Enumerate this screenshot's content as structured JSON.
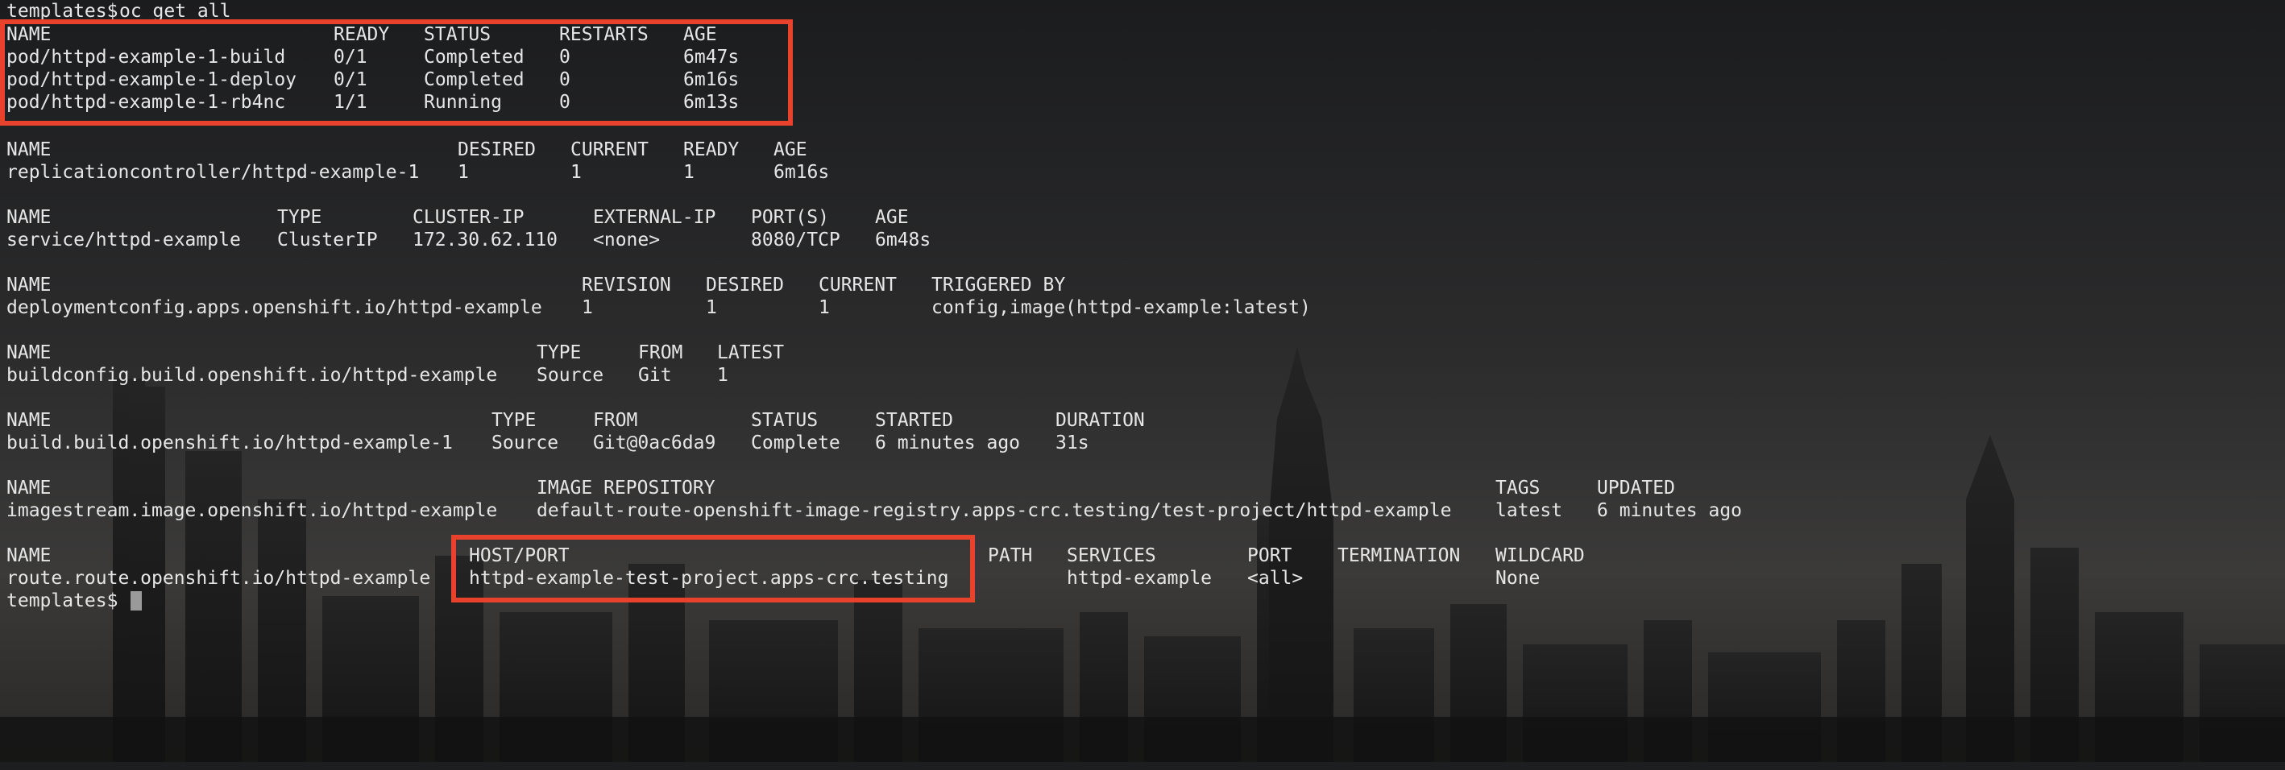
{
  "session": {
    "prompt": "templates$",
    "command": "oc get all"
  },
  "theme": {
    "text": "#e6e6e6",
    "highlight": "#e8422c",
    "background": "#1d1e20"
  },
  "pods": {
    "headers": [
      "NAME",
      "READY",
      "STATUS",
      "RESTARTS",
      "AGE"
    ],
    "rows": [
      [
        "pod/httpd-example-1-build",
        "0/1",
        "Completed",
        "0",
        "6m47s"
      ],
      [
        "pod/httpd-example-1-deploy",
        "0/1",
        "Completed",
        "0",
        "6m16s"
      ],
      [
        "pod/httpd-example-1-rb4nc",
        "1/1",
        "Running",
        "0",
        "6m13s"
      ]
    ]
  },
  "replicationcontrollers": {
    "headers": [
      "NAME",
      "DESIRED",
      "CURRENT",
      "READY",
      "AGE"
    ],
    "rows": [
      [
        "replicationcontroller/httpd-example-1",
        "1",
        "1",
        "1",
        "6m16s"
      ]
    ]
  },
  "services": {
    "headers": [
      "NAME",
      "TYPE",
      "CLUSTER-IP",
      "EXTERNAL-IP",
      "PORT(S)",
      "AGE"
    ],
    "rows": [
      [
        "service/httpd-example",
        "ClusterIP",
        "172.30.62.110",
        "<none>",
        "8080/TCP",
        "6m48s"
      ]
    ]
  },
  "deploymentconfigs": {
    "headers": [
      "NAME",
      "REVISION",
      "DESIRED",
      "CURRENT",
      "TRIGGERED BY"
    ],
    "rows": [
      [
        "deploymentconfig.apps.openshift.io/httpd-example",
        "1",
        "1",
        "1",
        "config,image(httpd-example:latest)"
      ]
    ]
  },
  "buildconfigs": {
    "headers": [
      "NAME",
      "TYPE",
      "FROM",
      "LATEST"
    ],
    "rows": [
      [
        "buildconfig.build.openshift.io/httpd-example",
        "Source",
        "Git",
        "1"
      ]
    ]
  },
  "builds": {
    "headers": [
      "NAME",
      "TYPE",
      "FROM",
      "STATUS",
      "STARTED",
      "DURATION"
    ],
    "rows": [
      [
        "build.build.openshift.io/httpd-example-1",
        "Source",
        "Git@0ac6da9",
        "Complete",
        "6 minutes ago",
        "31s"
      ]
    ]
  },
  "imagestreams": {
    "headers": [
      "NAME",
      "IMAGE REPOSITORY",
      "TAGS",
      "UPDATED"
    ],
    "rows": [
      [
        "imagestream.image.openshift.io/httpd-example",
        "default-route-openshift-image-registry.apps-crc.testing/test-project/httpd-example",
        "latest",
        "6 minutes ago"
      ]
    ]
  },
  "routes": {
    "headers": [
      "NAME",
      "HOST/PORT",
      "PATH",
      "SERVICES",
      "PORT",
      "TERMINATION",
      "WILDCARD"
    ],
    "rows": [
      [
        "route.route.openshift.io/httpd-example",
        "httpd-example-test-project.apps-crc.testing",
        "",
        "httpd-example",
        "<all>",
        "",
        "None"
      ]
    ]
  }
}
